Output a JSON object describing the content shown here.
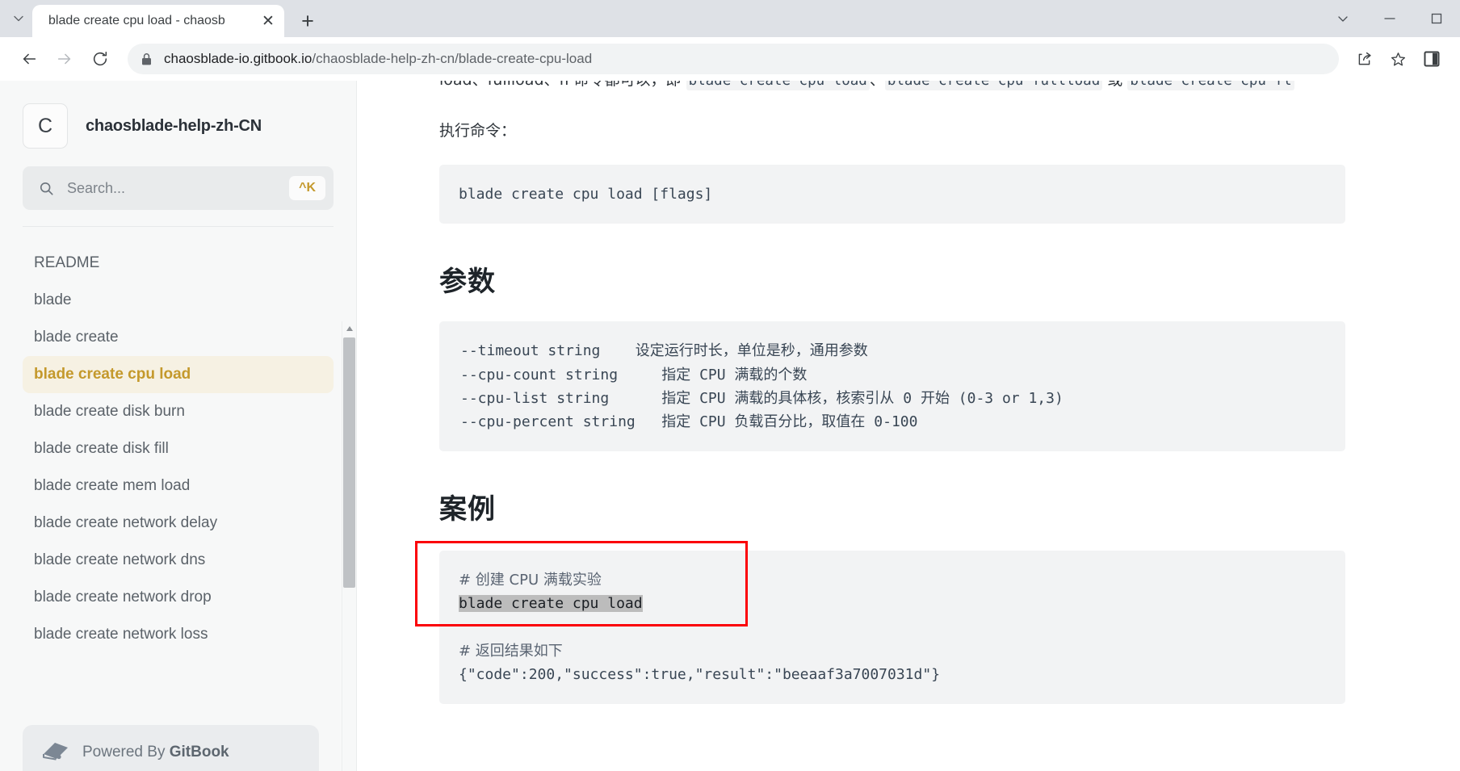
{
  "browser": {
    "tab": {
      "title": "blade create cpu load - chaosb",
      "close_label": "✕"
    },
    "new_tab_label": "+",
    "tab_search_icon": "chevron-down-icon",
    "window_controls": {
      "minimize": "—",
      "maximize": "❐"
    },
    "toolbar": {
      "back": "←",
      "forward": "→",
      "reload": "⟳",
      "url_host": "chaosblade-io.gitbook.io",
      "url_path": "/chaosblade-help-zh-cn/blade-create-cpu-load",
      "share_icon": "share-icon",
      "bookmark_icon": "star-icon",
      "panel_icon": "side-panel-icon"
    }
  },
  "sidebar": {
    "logo_letter": "C",
    "title": "chaosblade-help-zh-CN",
    "search": {
      "placeholder": "Search...",
      "value": "",
      "shortcut": "^K"
    },
    "items": [
      {
        "label": "README",
        "active": false
      },
      {
        "label": "blade",
        "active": false
      },
      {
        "label": "blade create",
        "active": false
      },
      {
        "label": "blade create cpu load",
        "active": true
      },
      {
        "label": "blade create disk burn",
        "active": false
      },
      {
        "label": "blade create disk fill",
        "active": false
      },
      {
        "label": "blade create mem load",
        "active": false
      },
      {
        "label": "blade create network delay",
        "active": false
      },
      {
        "label": "blade create network dns",
        "active": false
      },
      {
        "label": "blade create network drop",
        "active": false
      },
      {
        "label": "blade create network loss",
        "active": false
      }
    ],
    "footer": {
      "prefix": "Powered By ",
      "brand": "GitBook"
    }
  },
  "content": {
    "intro_clipped": {
      "t1": "load、fullload、fl 命令都可以，即 ",
      "c1": "blade create cpu load",
      "t2": "、",
      "c2": "blade create cpu fullload",
      "t3": " 或 ",
      "c3": "blade create cpu fl"
    },
    "exec_label": "执行命令：",
    "exec_code": "blade create cpu load [flags]",
    "params_heading": "参数",
    "params_code": "--timeout string    设定运行时长，单位是秒，通用参数\n--cpu-count string     指定 CPU 满载的个数\n--cpu-list string      指定 CPU 满载的具体核，核索引从 0 开始 (0-3 or 1,3)\n--cpu-percent string   指定 CPU 负载百分比，取值在 0-100",
    "examples_heading": "案例",
    "example": {
      "comment1": "# 创建 CPU 满载实验",
      "command_selected": "blade create cpu load",
      "comment2": "# 返回结果如下",
      "output": "{\"code\":200,\"success\":true,\"result\":\"beeaaf3a7007031d\"}"
    },
    "annotation": {
      "shape": "red-rectangle",
      "color": "#fb0007"
    }
  }
}
